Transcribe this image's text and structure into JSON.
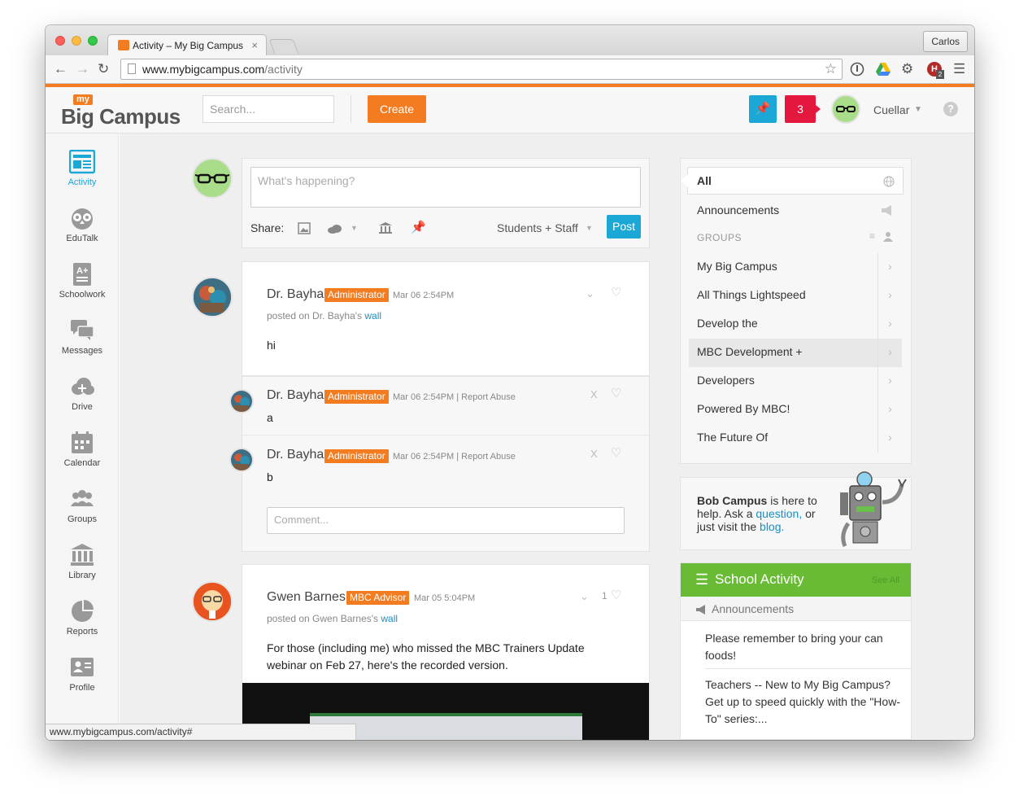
{
  "browser": {
    "tab_title": "Activity – My Big Campus",
    "tab_close": "×",
    "profile_name": "Carlos",
    "url_host": "www.mybigcampus.com",
    "url_path": "/activity",
    "status_url": "www.mybigcampus.com/activity#",
    "extension_badge": "2"
  },
  "header": {
    "logo_my": "my",
    "logo_big": "Big Campus",
    "search_placeholder": "Search...",
    "create_label": "Create",
    "notification_count": "3",
    "user_name": "Cuellar",
    "help": "?"
  },
  "nav": {
    "items": [
      {
        "label": "Activity",
        "icon": "activity-icon"
      },
      {
        "label": "EduTalk",
        "icon": "edutalk-owl-icon"
      },
      {
        "label": "Schoolwork",
        "icon": "schoolwork-icon"
      },
      {
        "label": "Messages",
        "icon": "messages-icon"
      },
      {
        "label": "Drive",
        "icon": "drive-cloud-icon"
      },
      {
        "label": "Calendar",
        "icon": "calendar-icon"
      },
      {
        "label": "Groups",
        "icon": "groups-icon"
      },
      {
        "label": "Library",
        "icon": "library-icon"
      },
      {
        "label": "Reports",
        "icon": "reports-icon"
      },
      {
        "label": "Profile",
        "icon": "profile-icon"
      }
    ],
    "active_color": "#1ba8d7"
  },
  "composer": {
    "placeholder": "What's happening?",
    "share_label": "Share:",
    "audience": "Students + Staff",
    "post_label": "Post"
  },
  "posts": [
    {
      "author": "Dr. Bayha",
      "role": "Administrator",
      "time": "Mar 06 2:54PM",
      "posted_prefix": "posted on Dr. Bayha's",
      "posted_link": "wall",
      "body": "hi",
      "comments": [
        {
          "author": "Dr. Bayha",
          "role": "Administrator",
          "time": "Mar 06 2:54PM | Report Abuse",
          "body": "a",
          "delete": "X"
        },
        {
          "author": "Dr. Bayha",
          "role": "Administrator",
          "time": "Mar 06 2:54PM | Report Abuse",
          "body": "b",
          "delete": "X"
        }
      ],
      "comment_placeholder": "Comment..."
    },
    {
      "author": "Gwen Barnes",
      "role": "MBC Advisor",
      "time": "Mar 05 5:04PM",
      "posted_prefix": "posted on Gwen Barnes's",
      "posted_link": "wall",
      "body": "For those (including me) who missed the MBC Trainers Update webinar on Feb 27, here's the recorded version.",
      "likes": "1"
    }
  ],
  "filters": {
    "all": "All",
    "announcements": "Announcements",
    "groups_heading": "GROUPS",
    "groups": [
      "My Big Campus",
      "All Things Lightspeed",
      "Develop the",
      "MBC Development +",
      "Developers",
      "Powered By MBC!",
      "The Future Of"
    ],
    "active_group_index": 3
  },
  "help_box": {
    "bold": "Bob Campus",
    "text1": " is here to help. Ask a ",
    "link1": "question,",
    "text2": " or just visit the ",
    "link2": "blog."
  },
  "school_activity": {
    "title": "School Activity",
    "see_all": "See All",
    "announcements_label": "Announcements",
    "items": [
      "Please remember to bring your can foods!",
      "Teachers -- New to My Big Campus? Get up to speed quickly with the \"How-To\" series:..."
    ]
  }
}
